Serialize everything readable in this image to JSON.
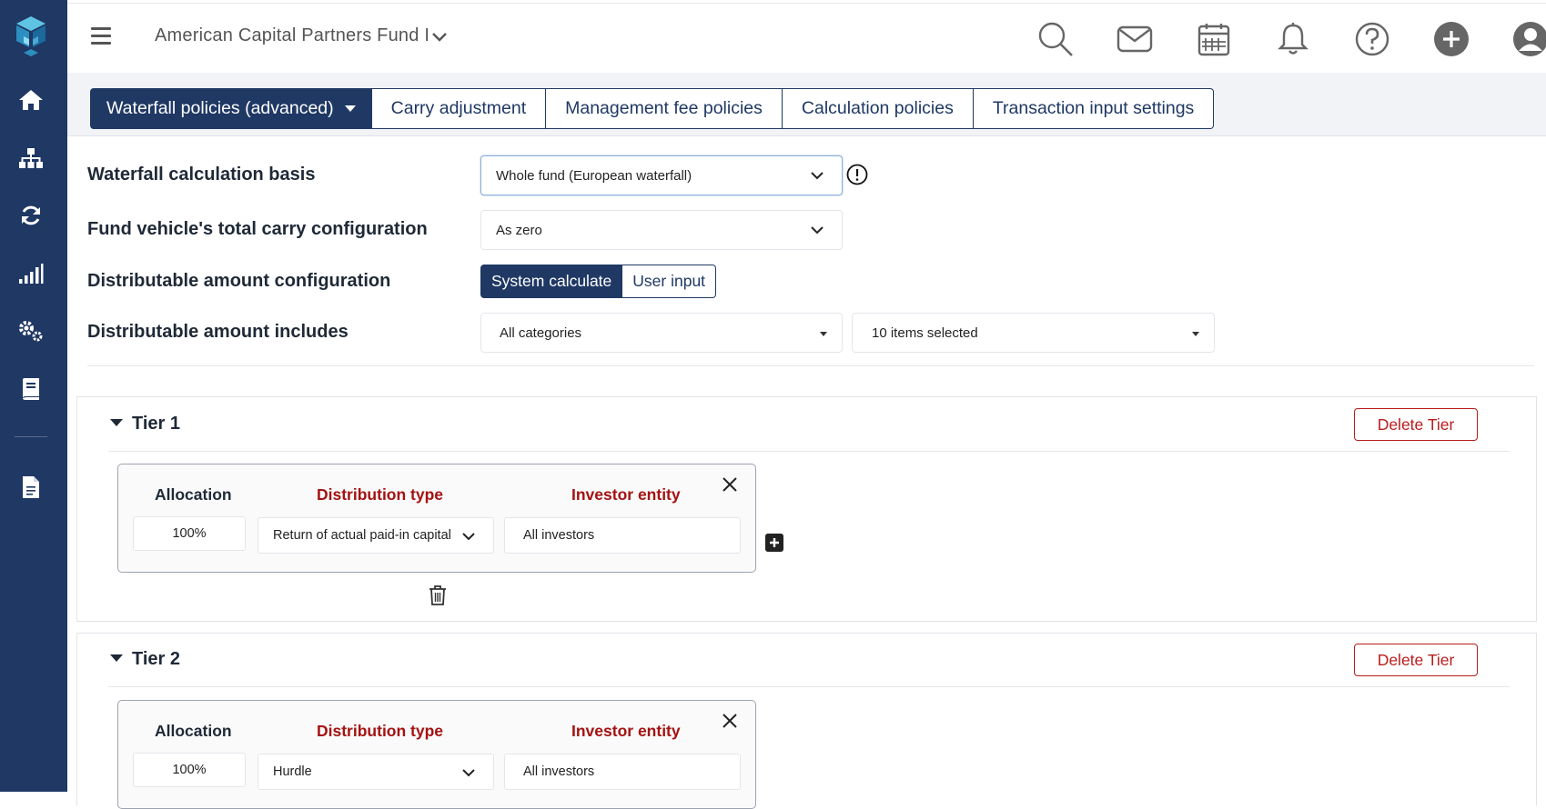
{
  "header": {
    "fund_name": "American Capital Partners Fund I"
  },
  "sidebar": {
    "items": [
      {
        "icon": "home-icon"
      },
      {
        "icon": "org-chart-icon"
      },
      {
        "icon": "refresh-icon"
      },
      {
        "icon": "signal-bars-icon"
      },
      {
        "icon": "gears-icon"
      },
      {
        "icon": "book-icon"
      },
      {
        "icon": "document-icon"
      }
    ]
  },
  "tabs": [
    {
      "label": "Waterfall policies (advanced)",
      "active": true
    },
    {
      "label": "Carry adjustment",
      "active": false
    },
    {
      "label": "Management fee policies",
      "active": false
    },
    {
      "label": "Calculation policies",
      "active": false
    },
    {
      "label": "Transaction input settings",
      "active": false
    }
  ],
  "form": {
    "calc_basis": {
      "label": "Waterfall calculation basis",
      "value": "Whole fund (European waterfall)"
    },
    "carry_config": {
      "label": "Fund vehicle's total carry configuration",
      "value": "As zero"
    },
    "distributable_config": {
      "label": "Distributable amount configuration",
      "options": [
        "System calculate",
        "User input"
      ],
      "selected": "System calculate"
    },
    "distributable_includes": {
      "label": "Distributable amount includes",
      "category_value": "All categories",
      "items_value": "10 items selected"
    }
  },
  "tiers": [
    {
      "title": "Tier 1",
      "delete_label": "Delete Tier",
      "headers": {
        "allocation": "Allocation",
        "distribution_type": "Distribution type",
        "investor_entity": "Investor entity"
      },
      "allocation": "100%",
      "distribution_type": "Return of actual paid-in capital",
      "investor_entity": "All investors"
    },
    {
      "title": "Tier 2",
      "delete_label": "Delete Tier",
      "headers": {
        "allocation": "Allocation",
        "distribution_type": "Distribution type",
        "investor_entity": "Investor entity"
      },
      "allocation": "100%",
      "distribution_type": "Hurdle",
      "investor_entity": "All investors"
    }
  ],
  "colors": {
    "navy": "#1f3864",
    "accent_red": "#a51212",
    "delete_red": "#b91c1c"
  }
}
